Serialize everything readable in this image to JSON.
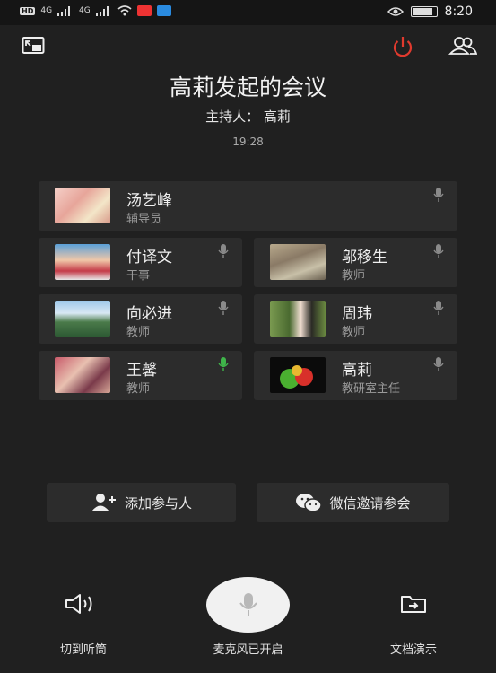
{
  "status_bar": {
    "hd": "HD",
    "net1": "4G",
    "net2": "4G",
    "time": "8:20",
    "battery_level": 0.8
  },
  "header": {
    "title": "高莉发起的会议",
    "host": "主持人：  高莉",
    "duration": "19:28"
  },
  "participants": [
    {
      "name": "汤艺峰",
      "role": "辅导员",
      "mic_active": false
    },
    {
      "name": "付译文",
      "role": "干事",
      "mic_active": false
    },
    {
      "name": "邬移生",
      "role": "教师",
      "mic_active": false
    },
    {
      "name": "向必进",
      "role": "教师",
      "mic_active": false
    },
    {
      "name": "周玮",
      "role": "教师",
      "mic_active": false
    },
    {
      "name": "王馨",
      "role": "教师",
      "mic_active": true
    },
    {
      "name": "高莉",
      "role": "教研室主任",
      "mic_active": false
    }
  ],
  "actions": {
    "add_participant": "添加参与人",
    "wechat_invite": "微信邀请参会"
  },
  "bottom_bar": {
    "earpiece": "切到听筒",
    "mic": "麦克风已开启",
    "doc": "文档演示"
  },
  "colors": {
    "background": "#202020",
    "card": "#2c2c2c",
    "hangup": "#e03a2e",
    "mic_active": "#3fb54a",
    "mic_idle": "#8a8a8a"
  }
}
